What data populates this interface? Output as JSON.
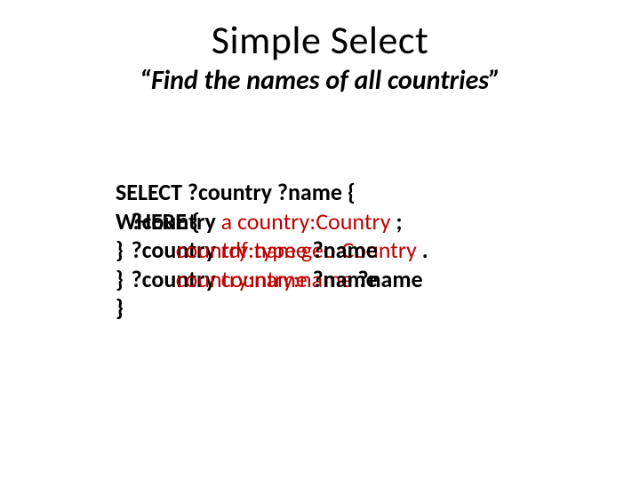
{
  "title": "Simple Select",
  "subtitle": "“Find the names of all countries”",
  "code_sparql": {
    "l1_a": "SELECT",
    "l1_b": " ?country ?name",
    "l1_c": " {",
    "l2_a": "WHERE {",
    "l3_a": "   ?country ",
    "l3_b": "rdf:type",
    "l3_c": " ",
    "l3_d": "geo:Country",
    "l3_e": " .",
    "l4_a": "   ?country ",
    "l4_b": "country:name",
    "l4_c": " ?name",
    "l5_a": "}"
  },
  "code_overlay": {
    "o1": "",
    "o2_a": "   ?country ",
    "o2_b": "a",
    "o2_c": " ",
    "o2_d": "country:Country",
    "o2_e": " ;",
    "o3_a": "}          ",
    "o3_b": "country:name",
    "o3_c": " ?name",
    "o4_a": "}          ",
    "o4_b": "country:name",
    "o4_c": " ?name",
    "o5": "}"
  }
}
